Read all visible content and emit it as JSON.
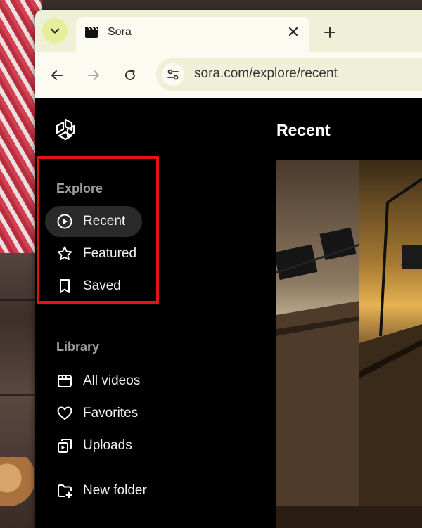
{
  "browser": {
    "tab": {
      "title": "Sora"
    },
    "address_bar": {
      "url": "sora.com/explore/recent"
    }
  },
  "page": {
    "title": "Recent"
  },
  "sidebar": {
    "explore": {
      "heading": "Explore",
      "items": [
        {
          "label": "Recent",
          "icon": "play-circle-icon",
          "active": true
        },
        {
          "label": "Featured",
          "icon": "star-icon",
          "active": false
        },
        {
          "label": "Saved",
          "icon": "bookmark-icon",
          "active": false
        }
      ]
    },
    "library": {
      "heading": "Library",
      "items": [
        {
          "label": "All videos",
          "icon": "clapperboard-icon"
        },
        {
          "label": "Favorites",
          "icon": "heart-icon"
        },
        {
          "label": "Uploads",
          "icon": "uploads-icon"
        }
      ]
    },
    "new_folder": {
      "label": "New folder",
      "icon": "folder-plus-icon"
    }
  },
  "colors": {
    "annotation_box": "#e01414",
    "tabstrip_bg": "#eef0d8",
    "page_bg": "#000000"
  }
}
